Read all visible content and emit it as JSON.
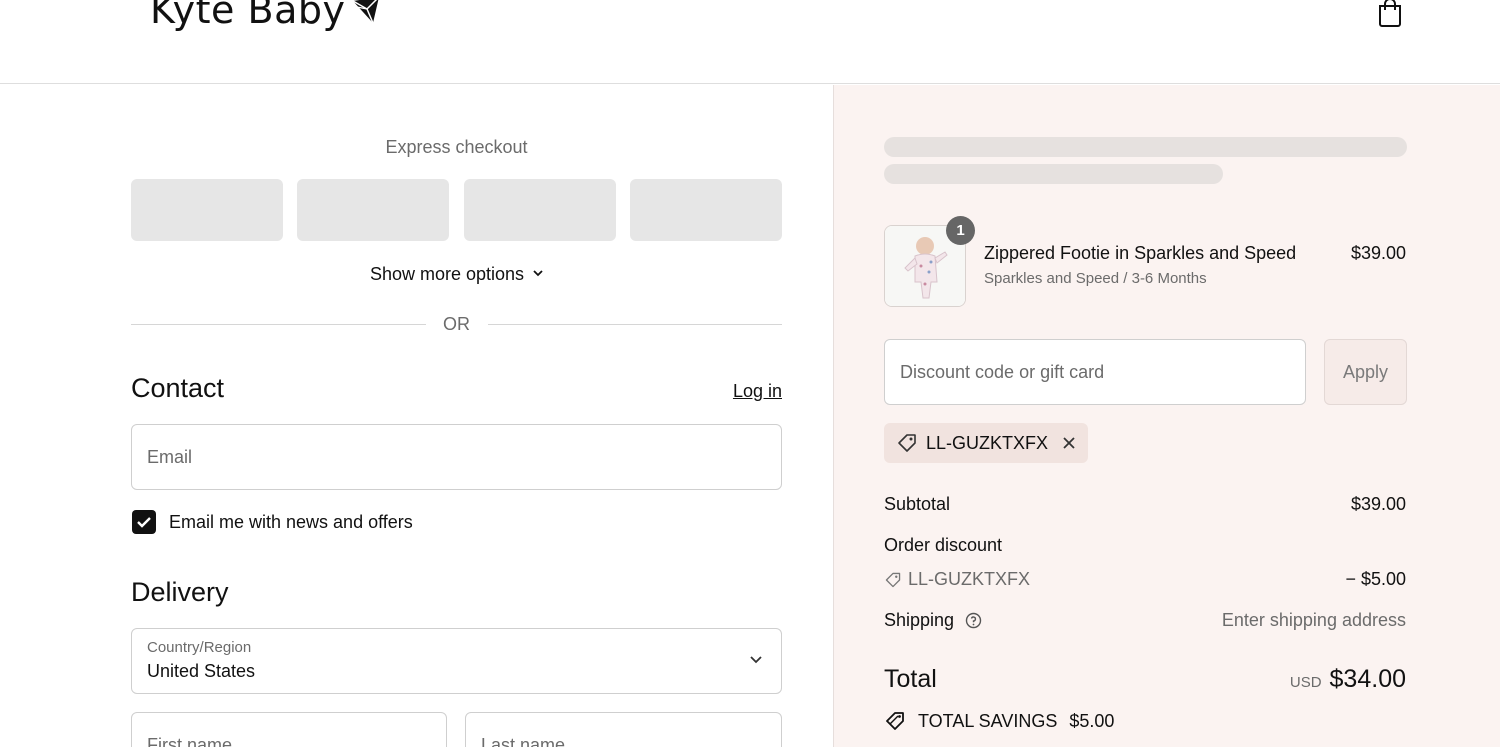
{
  "header": {
    "brand": "Kyte Baby",
    "cart_icon": "shopping-bag-icon"
  },
  "express": {
    "title": "Express checkout",
    "show_more": "Show more options",
    "or": "OR"
  },
  "contact": {
    "title": "Contact",
    "login": "Log in",
    "email_placeholder": "Email",
    "newsletter_label": "Email me with news and offers",
    "newsletter_checked": true
  },
  "delivery": {
    "title": "Delivery",
    "country_label": "Country/Region",
    "country_value": "United States",
    "first_name_placeholder": "First name",
    "last_name_placeholder": "Last name"
  },
  "summary": {
    "item": {
      "quantity": "1",
      "name": "Zippered Footie in Sparkles and Speed",
      "variant": "Sparkles and Speed / 3-6 Months",
      "price": "$39.00"
    },
    "discount_placeholder": "Discount code or gift card",
    "apply": "Apply",
    "applied_code": "LL-GUZKTXFX",
    "subtotal_label": "Subtotal",
    "subtotal_value": "$39.00",
    "order_discount_label": "Order discount",
    "order_discount_code": "LL-GUZKTXFX",
    "order_discount_value": "− $5.00",
    "shipping_label": "Shipping",
    "shipping_value": "Enter shipping address",
    "total_label": "Total",
    "total_currency": "USD",
    "total_value": "$34.00",
    "savings_label": "TOTAL SAVINGS",
    "savings_value": "$5.00"
  },
  "colors": {
    "summary_bg": "#fbf3f1",
    "chip_bg": "#f1e3df",
    "accent": "#111111"
  }
}
